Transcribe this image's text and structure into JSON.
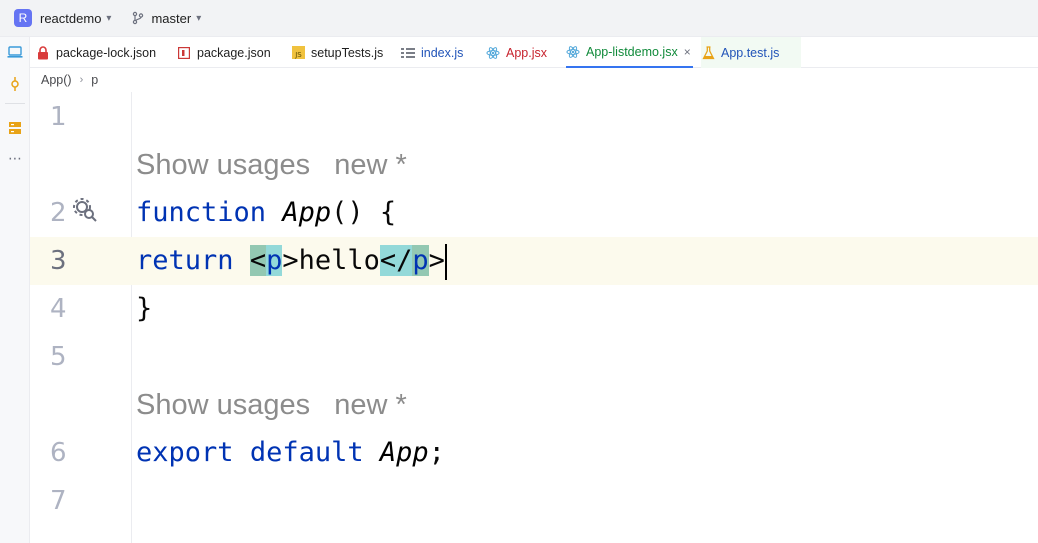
{
  "titlebar": {
    "project_badge": "R",
    "project_name": "reactdemo",
    "branch": "master"
  },
  "tabs": [
    {
      "label": "package-lock.json",
      "icon": "lock-file-icon",
      "color": "#1f1f1f"
    },
    {
      "label": "package.json",
      "icon": "npm-icon",
      "color": "#1f1f1f"
    },
    {
      "label": "setupTests.js",
      "icon": "js-icon",
      "color": "#1f1f1f"
    },
    {
      "label": "index.js",
      "icon": "list-icon",
      "color": "#2154b8"
    },
    {
      "label": "App.jsx",
      "icon": "react-icon",
      "color": "#c7222d"
    },
    {
      "label": "App-listdemo.jsx",
      "icon": "react-icon",
      "color": "#108a3a",
      "active": true
    },
    {
      "label": "App.test.js",
      "icon": "test-flask-icon",
      "color": "#2154b8"
    }
  ],
  "tab_close": "×",
  "breadcrumb": {
    "item1": "App()",
    "item2": "p"
  },
  "editor": {
    "line_numbers": [
      "1",
      "2",
      "3",
      "4",
      "5",
      "6",
      "7"
    ],
    "hint1": "Show usages   new *",
    "hint2": "Show usages   new *",
    "line2": {
      "kw": "function",
      "fn": "App",
      "rest": "() {"
    },
    "line3": {
      "kw": "return",
      "open_lt": "<",
      "open_tag": "p",
      "open_gt": ">",
      "text": "hello",
      "close_lt": "</",
      "close_tag": "p",
      "close_gt": ">"
    },
    "line4": "}",
    "line6": {
      "kw1": "export",
      "kw2": "default",
      "fn": "App",
      "semi": ";"
    }
  },
  "colors": {
    "accent": "#3574f0",
    "keyword": "#0033b3",
    "current_line": "#fcfaed"
  }
}
